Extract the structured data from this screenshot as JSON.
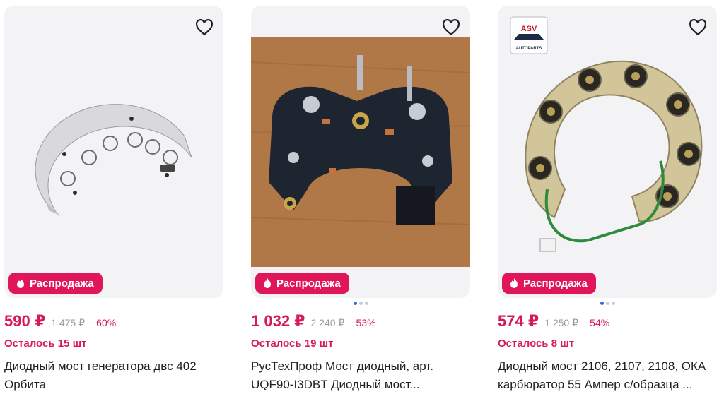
{
  "products": [
    {
      "price": "590 ₽",
      "old_price": "1 475 ₽",
      "discount": "−60%",
      "badge": "Распродажа",
      "stock": "Осталось 15 шт",
      "title": "Диодный мост генератора двс 402 Орбита",
      "image_dots": 0
    },
    {
      "price": "1 032 ₽",
      "old_price": "2 240 ₽",
      "discount": "−53%",
      "badge": "Распродажа",
      "stock": "Осталось 19 шт",
      "title": "РусТехПроф Мост диодный, арт. UQF90-I3DBT Диодный мост...",
      "image_dots": 3
    },
    {
      "price": "574 ₽",
      "old_price": "1 250 ₽",
      "discount": "−54%",
      "badge": "Распродажа",
      "stock": "Осталось 8 шт",
      "title": "Диодный мост 2106, 2107, 2108, ОКА карбюратор 55 Ампер с/образца ...",
      "image_dots": 3,
      "brand_logo": "ASV AUTOPARTS"
    }
  ],
  "colors": {
    "accent": "#d7195c",
    "badge_bg": "#e0155a",
    "card_bg": "#f3f3f6",
    "dot_active": "#3b63f2"
  },
  "icons": {
    "favorite": "heart-outline-icon",
    "badge": "fire-icon"
  }
}
